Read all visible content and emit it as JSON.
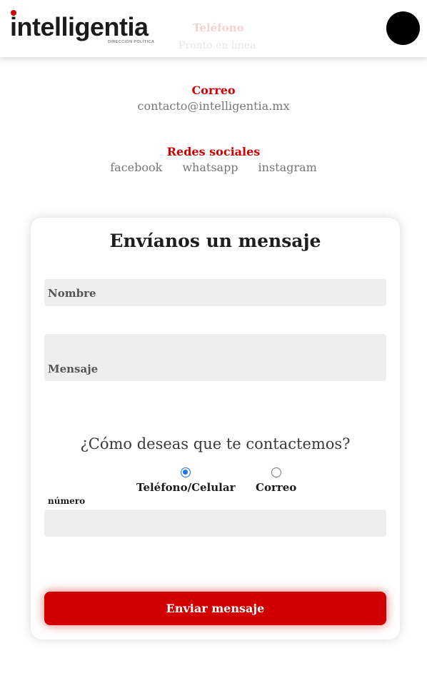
{
  "header": {
    "logo_text": "intelligentia",
    "logo_subtitle": "DIRECCIÓN POLÍTICA",
    "ghost_section_title": "Teléfono",
    "ghost_section_value": "Pronto en línea"
  },
  "contact": {
    "email_title": "Correo",
    "email_value": "contacto@intelligentia.mx",
    "social_title": "Redes sociales",
    "social_links": [
      "facebook",
      "whatsapp",
      "instagram"
    ]
  },
  "form": {
    "title": "Envíanos un mensaje",
    "name_placeholder": "Nombre",
    "message_placeholder": "Mensaje",
    "question": "¿Cómo deseas que te contactemos?",
    "options": [
      {
        "label": "Teléfono/Celular",
        "checked": true
      },
      {
        "label": "Correo",
        "checked": false
      }
    ],
    "number_label": "número",
    "number_value": "",
    "submit_label": "Enviar mensaje"
  },
  "colors": {
    "accent": "#d10000",
    "muted_text": "#777777",
    "field_bg": "#eeeeee",
    "radio_selected": "#1a73e8"
  }
}
